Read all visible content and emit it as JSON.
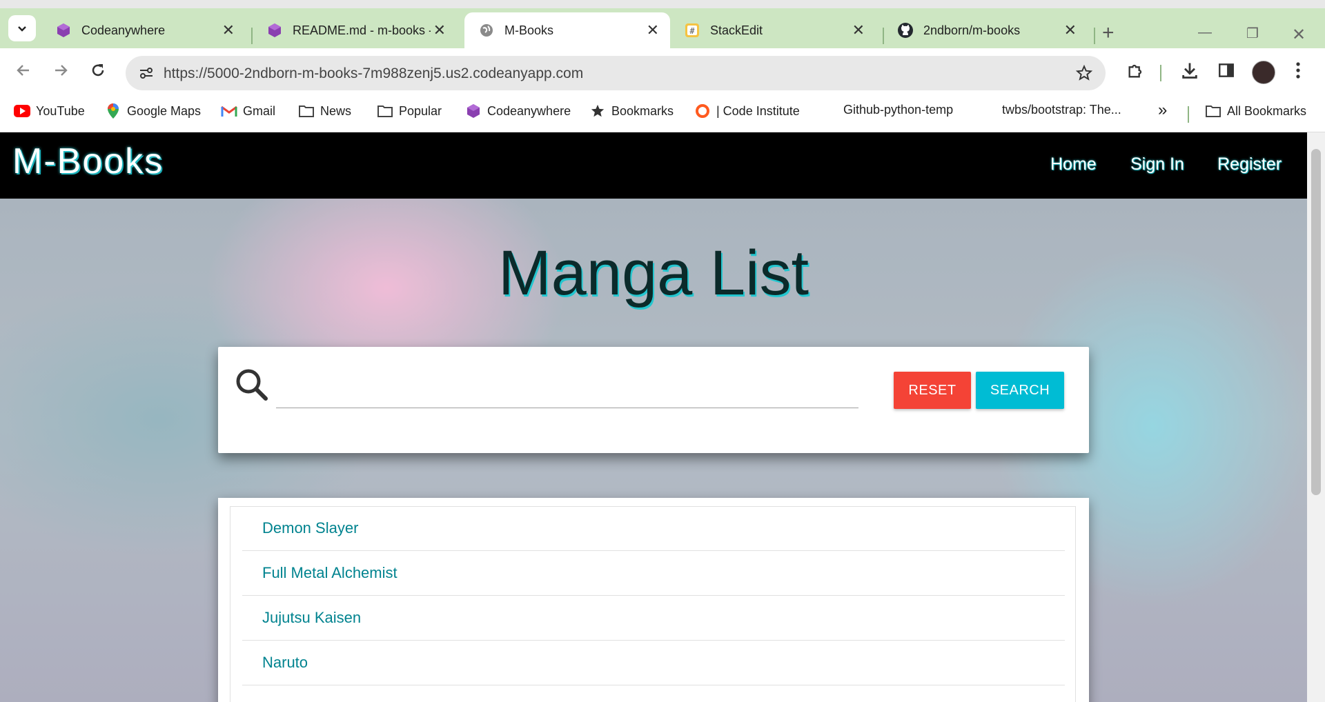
{
  "browser": {
    "tabs": [
      {
        "title": "Codeanywhere",
        "icon": "codeanywhere-icon"
      },
      {
        "title": "README.md - m-books -",
        "icon": "codeanywhere-icon"
      },
      {
        "title": "M-Books",
        "icon": "globe-icon",
        "active": true
      },
      {
        "title": "StackEdit",
        "icon": "stackedit-icon"
      },
      {
        "title": "2ndborn/m-books",
        "icon": "github-icon"
      }
    ],
    "url": "https://5000-2ndborn-m-books-7m988zenj5.us2.codeanyapp.com",
    "bookmarks": [
      {
        "label": "YouTube",
        "icon": "youtube-icon"
      },
      {
        "label": "Google Maps",
        "icon": "maps-pin-icon"
      },
      {
        "label": "Gmail",
        "icon": "gmail-icon"
      },
      {
        "label": "News",
        "icon": "folder-icon"
      },
      {
        "label": "Popular",
        "icon": "folder-icon"
      },
      {
        "label": "Codeanywhere",
        "icon": "codeanywhere-icon"
      },
      {
        "label": "Bookmarks",
        "icon": "star-icon"
      },
      {
        "label": "| Code Institute",
        "icon": "code-institute-icon"
      },
      {
        "label": "Github-python-temp",
        "icon": ""
      },
      {
        "label": "twbs/bootstrap: The...",
        "icon": ""
      }
    ],
    "all_bookmarks_label": "All Bookmarks",
    "overflow_label": "»"
  },
  "site": {
    "brand": "M-Books",
    "nav": [
      "Home",
      "Sign In",
      "Register"
    ]
  },
  "main": {
    "title": "Manga List",
    "search": {
      "placeholder": "",
      "value": "",
      "reset_label": "RESET",
      "search_label": "SEARCH"
    },
    "manga": [
      "Demon Slayer",
      "Full Metal Alchemist",
      "Jujutsu Kaisen",
      "Naruto"
    ]
  },
  "colors": {
    "nav_bg": "#000000",
    "accent_cyan": "#00bcd4",
    "reset_red": "#f44336",
    "link_teal": "#00838f",
    "tabstrip": "#cde6c2"
  }
}
